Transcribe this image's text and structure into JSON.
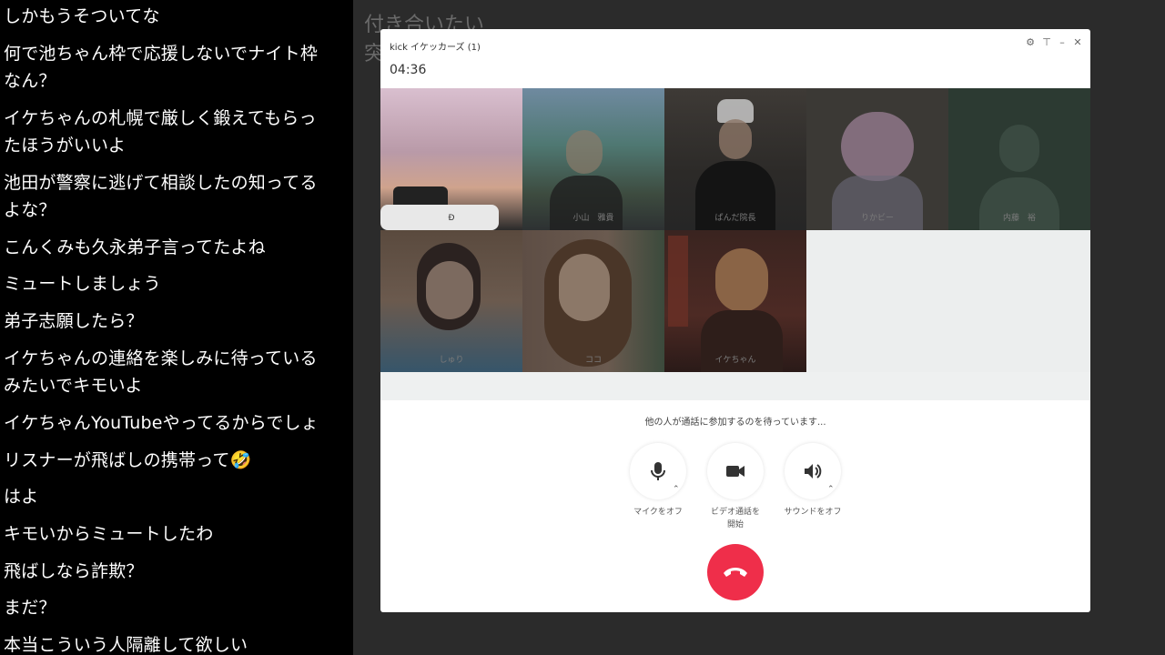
{
  "chat": {
    "lines": [
      "しかもうそついてな",
      "何で池ちゃん枠で応援しないでナイト枠",
      "なん？",
      "イケちゃんの札幌で厳しく鍛えてもらっ",
      "たほうがいいよ",
      "池田が警察に逃げて相談したの知ってる",
      "よな？",
      "こんくみも久永弟子言ってたよね",
      "ミュートしましょう",
      "弟子志願したら？",
      "イケちゃんの連絡を楽しみに待っている",
      "みたいでキモいよ",
      "イケちゃんYouTubeやってるからでしょ",
      "リスナーが飛ばしの携帯って🤣",
      "はよ",
      "キモいからミュートしたわ",
      "飛ばしなら詐欺？",
      "まだ？",
      "本当こういう人隔離して欲しい"
    ]
  },
  "background_text": {
    "line1": "付き合いたい",
    "line2": "突"
  },
  "call_window": {
    "title": "kick イケッカーズ   (1)",
    "timer": "04:36",
    "controls": {
      "settings": "⚙",
      "pin": "⊤",
      "minimize": "–",
      "close": "✕"
    },
    "participants": [
      {
        "name": "Ð"
      },
      {
        "name": "小山　雅貴"
      },
      {
        "name": "ぱんだ院長"
      },
      {
        "name": "りかビー"
      },
      {
        "name": "内藤　裕"
      },
      {
        "name": "しゅり"
      },
      {
        "name": "ココ"
      },
      {
        "name": "イケちゃん"
      }
    ],
    "status_text": "他の人が通話に参加するのを待っています...",
    "buttons": {
      "mic_label": "マイクをオフ",
      "video_label_1": "ビデオ通話を",
      "video_label_2": "開始",
      "sound_label": "サウンドをオフ"
    },
    "colors": {
      "hangup": "#ef2e4a",
      "grid_bg": "#e9ecec"
    },
    "icons": {
      "mic": "mic-icon",
      "video": "video-camera-icon",
      "sound": "speaker-icon",
      "hangup": "phone-hangup-icon"
    }
  }
}
